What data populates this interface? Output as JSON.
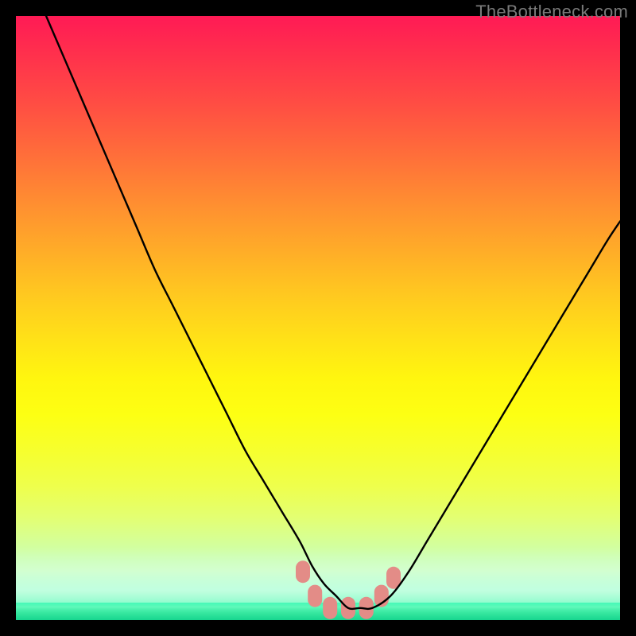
{
  "watermark": "TheBottleneck.com",
  "chart_data": {
    "type": "line",
    "title": "",
    "xlabel": "",
    "ylabel": "",
    "xlim": [
      0,
      100
    ],
    "ylim": [
      0,
      100
    ],
    "background_gradient": {
      "top": "#ff1a55",
      "mid": "#fff60f",
      "bottom": "#14d88e"
    },
    "series": [
      {
        "name": "bottleneck-curve",
        "x": [
          5,
          8,
          11,
          14,
          17,
          20,
          23,
          26,
          29,
          32,
          35,
          38,
          41,
          44,
          47,
          49,
          51,
          53,
          55,
          57,
          59,
          62,
          65,
          68,
          71,
          74,
          77,
          80,
          83,
          86,
          89,
          92,
          95,
          98,
          100
        ],
        "values": [
          100,
          93,
          86,
          79,
          72,
          65,
          58,
          52,
          46,
          40,
          34,
          28,
          23,
          18,
          13,
          9,
          6,
          4,
          2,
          2,
          2,
          4,
          8,
          13,
          18,
          23,
          28,
          33,
          38,
          43,
          48,
          53,
          58,
          63,
          66
        ]
      }
    ],
    "markers": {
      "name": "floor-markers",
      "color": "#e38c87",
      "points": [
        {
          "x": 47.5,
          "y": 8
        },
        {
          "x": 49.5,
          "y": 4
        },
        {
          "x": 52,
          "y": 2
        },
        {
          "x": 55,
          "y": 2
        },
        {
          "x": 58,
          "y": 2
        },
        {
          "x": 60.5,
          "y": 4
        },
        {
          "x": 62.5,
          "y": 7
        }
      ]
    }
  }
}
